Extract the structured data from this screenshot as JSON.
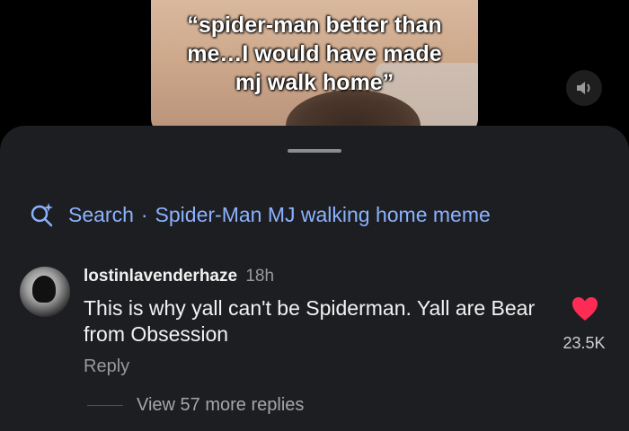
{
  "video": {
    "caption_lines": [
      "“spider-man better than",
      "me…I would have made",
      "mj walk home”"
    ]
  },
  "icons": {
    "volume": "volume-icon",
    "search": "search-sparkle-icon",
    "like": "heart-icon"
  },
  "colors": {
    "search_accent": "#8cb2ff",
    "like_red": "#fe2c55",
    "sheet_bg": "#1c1e21"
  },
  "search": {
    "label": "Search",
    "separator": "·",
    "query": "Spider-Man MJ walking home meme"
  },
  "comment": {
    "username": "lostinlavenderhaze",
    "time": "18h",
    "text": "This is why yall can't be Spiderman. Yall are Bear from Obsession",
    "reply_label": "Reply",
    "like_count": "23.5K",
    "view_replies": "View 57 more replies"
  }
}
